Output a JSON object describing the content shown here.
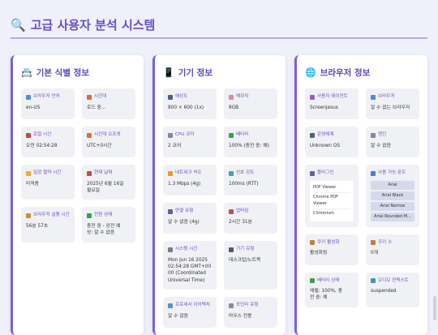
{
  "title": "고급 사용자 분석 시스템",
  "colors": {
    "accent": "#6a4fc8",
    "panel_border": "#7b5fd6",
    "card": "#f0f1f5"
  },
  "panels": [
    {
      "title": "기본 식별 정보",
      "icon": "id-card-icon",
      "cards": [
        {
          "label": "브라우저 언어",
          "value": "en-US",
          "icon": "globe-icon"
        },
        {
          "label": "시간대",
          "value": "로드 중...",
          "icon": "clock-icon"
        },
        {
          "label": "로컬 시간",
          "value": "오전 02:54:28",
          "icon": "calendar-icon"
        },
        {
          "label": "시간대 오프셋",
          "value": "UTC+0시간",
          "icon": "alarm-icon"
        },
        {
          "label": "일광 절약 시간",
          "value": "미적용",
          "icon": "sun-icon"
        },
        {
          "label": "현재 날짜",
          "value": "2025년 6월 16일\n월요일",
          "icon": "calendar-icon"
        },
        {
          "label": "브라우저 실행 시간",
          "value": "56분 57초",
          "icon": "hourglass-icon"
        },
        {
          "label": "전원 상태",
          "value": "충전 중 - 완전 예\n상: 알 수 없음",
          "icon": "battery-icon"
        }
      ]
    },
    {
      "title": "기기 정보",
      "icon": "phone-icon",
      "cards": [
        {
          "label": "해상도",
          "value": "800 × 600 (1x)",
          "icon": "monitor-icon"
        },
        {
          "label": "메모리",
          "value": "8GB",
          "icon": "brain-icon"
        },
        {
          "label": "CPU 코어",
          "value": "2 코어",
          "icon": "gear-icon"
        },
        {
          "label": "배터리",
          "value": "100% (충전 중: 예)",
          "icon": "battery-icon"
        },
        {
          "label": "네트워크 속도",
          "value": "1.3 Mbps (4g)",
          "icon": "signal-icon"
        },
        {
          "label": "신호 강도",
          "value": "100ms (RTT)",
          "icon": "wifi-icon"
        },
        {
          "label": "연결 유형",
          "value": "알 수 없음 (4g)",
          "icon": "plug-icon"
        },
        {
          "label": "업타임",
          "value": "2시간 31분",
          "icon": "timer-icon"
        },
        {
          "label": "시스템 시간",
          "value": "Mon Jun 16 2025\n02:54:28 GMT+00\n00 (Coordinated\nUniversal Time)",
          "icon": "watch-icon"
        },
        {
          "label": "기기 유형",
          "value": "데스크탑/노트북",
          "icon": "phone-icon"
        },
        {
          "label": "프로세서 아키텍처",
          "value": "알 수 없음",
          "icon": "chip-icon"
        },
        {
          "label": "포인터 유형",
          "value": "마우스 전용",
          "icon": "mouse-icon"
        }
      ]
    },
    {
      "title": "브라우저 정보",
      "icon": "globe-icon",
      "cards": [
        {
          "label": "사용자 에이전트",
          "value": "Screenjesus",
          "icon": "id-icon"
        },
        {
          "label": "브라우저",
          "value": "알 수 없는 브라우저",
          "icon": "search-icon"
        },
        {
          "label": "운영체제",
          "value": "Unknown OS",
          "icon": "laptop-icon"
        },
        {
          "label": "엔진",
          "value": "알 수 없음",
          "icon": "gear-icon"
        },
        {
          "label": "플러그인",
          "plugins": [
            "PDF Viewer",
            "Chrome PDF Viewer",
            "Chromium"
          ],
          "icon": "plug-icon"
        },
        {
          "label": "사용 가능 폰트",
          "fonts": [
            "Arial",
            "Arial Black",
            "Arial Narrow",
            "Arial Rounded M..."
          ],
          "icon": "font-icon"
        },
        {
          "label": "쿠키 활성화",
          "value": "활성화됨",
          "icon": "cookie-icon"
        },
        {
          "label": "쿠키 수",
          "value": "0개",
          "icon": "cookie-icon"
        },
        {
          "label": "배터리 상태",
          "value": "레벨: 100%, 충\n전 중: 예",
          "icon": "battery-icon"
        },
        {
          "label": "오디오 컨텍스트",
          "value": "suspended",
          "icon": "speaker-icon"
        }
      ]
    }
  ]
}
